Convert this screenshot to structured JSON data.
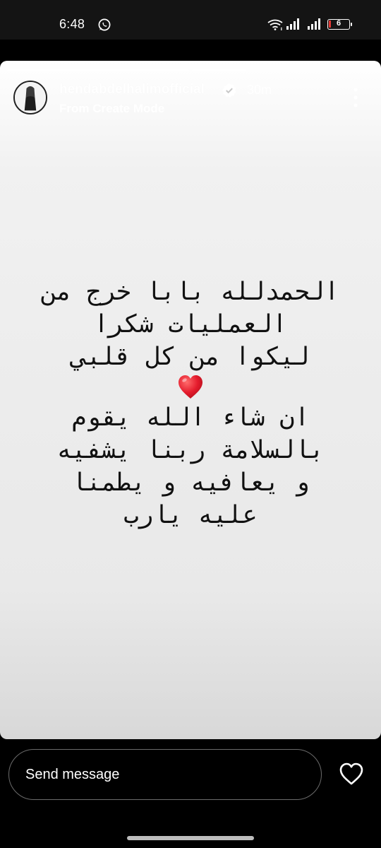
{
  "status_bar": {
    "time": "6:48",
    "battery_level": "6",
    "battery_color": "#e53935"
  },
  "story": {
    "username": "hendabdelhalimofficial",
    "verified": true,
    "time_ago": "30m",
    "subtitle": "From Create Mode",
    "progress": [
      1.0,
      0.3
    ],
    "text_lines": [
      "الحمدلله بابا خرج من",
      "العمليات شكرا",
      "ليكوا من كل قلبي",
      "ان شاء الله يقوم",
      "بالسلامة ربنا يشفيه",
      "و يعافيه و يطمنا",
      "عليه يارب"
    ],
    "emoji": "heart-emoji",
    "text_color": "#111111"
  },
  "footer": {
    "message_placeholder": "Send message",
    "like_icon": "heart-outline-icon"
  },
  "icons": {
    "whatsapp": "whatsapp-icon",
    "wifi": "wifi-icon",
    "signal": "signal-icon",
    "verified": "verified-badge-icon",
    "more": "more-vertical-icon"
  }
}
